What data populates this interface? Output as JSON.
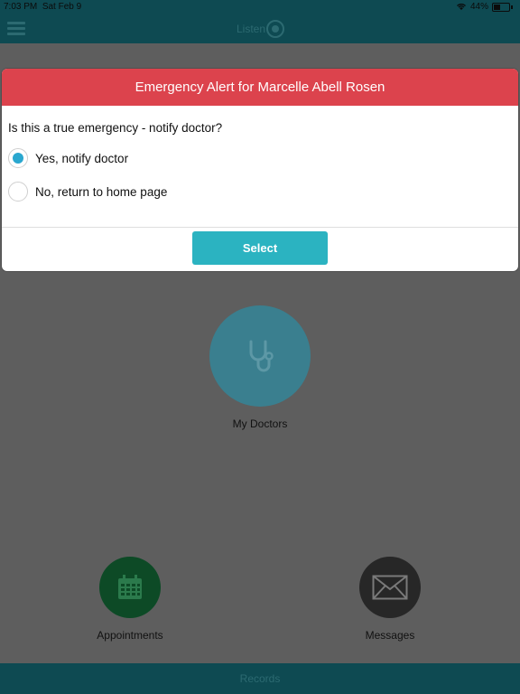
{
  "status_bar": {
    "time": "7:03 PM",
    "date": "Sat Feb 9",
    "battery": "44%",
    "battery_level": 0.44
  },
  "header": {
    "logo_text": "Listen"
  },
  "modal": {
    "title": "Emergency Alert for Marcelle Abell Rosen",
    "question": "Is this a true emergency - notify doctor?",
    "options": [
      {
        "label": "Yes, notify doctor",
        "selected": true
      },
      {
        "label": "No, return to home page",
        "selected": false
      }
    ],
    "select_label": "Select"
  },
  "tiles": {
    "doctors": {
      "label": "My Doctors",
      "icon": "stethoscope-icon"
    },
    "appointments": {
      "label": "Appointments",
      "icon": "calendar-icon"
    },
    "messages": {
      "label": "Messages",
      "icon": "envelope-icon"
    }
  },
  "bottom_bar": {
    "label": "Records"
  },
  "colors": {
    "alert_red": "#dc434d",
    "accent_teal": "#2bb3c1",
    "radio_blue": "#2aa7cf"
  }
}
